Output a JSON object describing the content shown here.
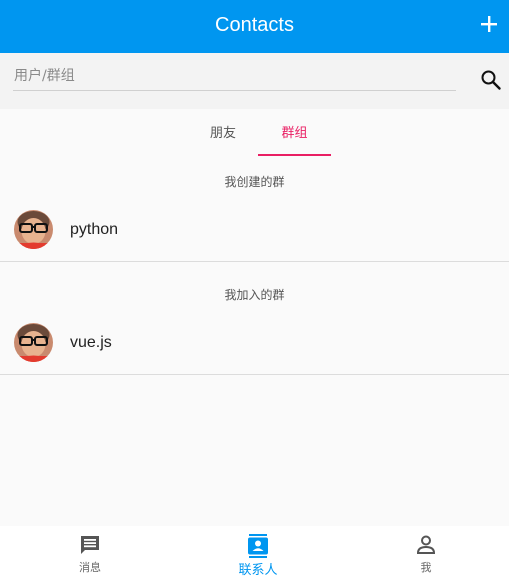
{
  "header": {
    "title": "Contacts",
    "add_icon": "plus-icon"
  },
  "search": {
    "placeholder": "用户/群组",
    "value": "",
    "icon": "search-icon"
  },
  "tabs": [
    {
      "label": "朋友",
      "active": false
    },
    {
      "label": "群组",
      "active": true
    }
  ],
  "sections": [
    {
      "title": "我创建的群",
      "groups": [
        {
          "name": "python",
          "avatar_icon": "avatar"
        }
      ]
    },
    {
      "title": "我加入的群",
      "groups": [
        {
          "name": "vue.js",
          "avatar_icon": "avatar"
        }
      ]
    }
  ],
  "bottom_nav": [
    {
      "label": "消息",
      "icon": "message-icon",
      "active": false
    },
    {
      "label": "联系人",
      "icon": "contacts-icon",
      "active": true
    },
    {
      "label": "我",
      "icon": "person-icon",
      "active": false
    }
  ],
  "colors": {
    "primary": "#0096f0",
    "accent": "#e91e63",
    "background": "#fafafa"
  }
}
